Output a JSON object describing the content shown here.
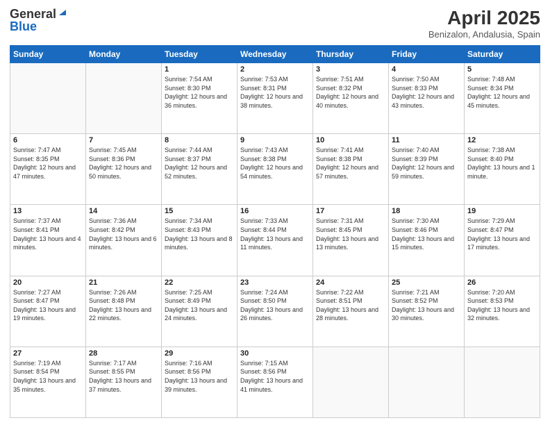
{
  "header": {
    "logo_general": "General",
    "logo_blue": "Blue",
    "month_title": "April 2025",
    "location": "Benizalon, Andalusia, Spain"
  },
  "days_of_week": [
    "Sunday",
    "Monday",
    "Tuesday",
    "Wednesday",
    "Thursday",
    "Friday",
    "Saturday"
  ],
  "weeks": [
    [
      {
        "day": "",
        "sunrise": "",
        "sunset": "",
        "daylight": ""
      },
      {
        "day": "",
        "sunrise": "",
        "sunset": "",
        "daylight": ""
      },
      {
        "day": "1",
        "sunrise": "Sunrise: 7:54 AM",
        "sunset": "Sunset: 8:30 PM",
        "daylight": "Daylight: 12 hours and 36 minutes."
      },
      {
        "day": "2",
        "sunrise": "Sunrise: 7:53 AM",
        "sunset": "Sunset: 8:31 PM",
        "daylight": "Daylight: 12 hours and 38 minutes."
      },
      {
        "day": "3",
        "sunrise": "Sunrise: 7:51 AM",
        "sunset": "Sunset: 8:32 PM",
        "daylight": "Daylight: 12 hours and 40 minutes."
      },
      {
        "day": "4",
        "sunrise": "Sunrise: 7:50 AM",
        "sunset": "Sunset: 8:33 PM",
        "daylight": "Daylight: 12 hours and 43 minutes."
      },
      {
        "day": "5",
        "sunrise": "Sunrise: 7:48 AM",
        "sunset": "Sunset: 8:34 PM",
        "daylight": "Daylight: 12 hours and 45 minutes."
      }
    ],
    [
      {
        "day": "6",
        "sunrise": "Sunrise: 7:47 AM",
        "sunset": "Sunset: 8:35 PM",
        "daylight": "Daylight: 12 hours and 47 minutes."
      },
      {
        "day": "7",
        "sunrise": "Sunrise: 7:45 AM",
        "sunset": "Sunset: 8:36 PM",
        "daylight": "Daylight: 12 hours and 50 minutes."
      },
      {
        "day": "8",
        "sunrise": "Sunrise: 7:44 AM",
        "sunset": "Sunset: 8:37 PM",
        "daylight": "Daylight: 12 hours and 52 minutes."
      },
      {
        "day": "9",
        "sunrise": "Sunrise: 7:43 AM",
        "sunset": "Sunset: 8:38 PM",
        "daylight": "Daylight: 12 hours and 54 minutes."
      },
      {
        "day": "10",
        "sunrise": "Sunrise: 7:41 AM",
        "sunset": "Sunset: 8:38 PM",
        "daylight": "Daylight: 12 hours and 57 minutes."
      },
      {
        "day": "11",
        "sunrise": "Sunrise: 7:40 AM",
        "sunset": "Sunset: 8:39 PM",
        "daylight": "Daylight: 12 hours and 59 minutes."
      },
      {
        "day": "12",
        "sunrise": "Sunrise: 7:38 AM",
        "sunset": "Sunset: 8:40 PM",
        "daylight": "Daylight: 13 hours and 1 minute."
      }
    ],
    [
      {
        "day": "13",
        "sunrise": "Sunrise: 7:37 AM",
        "sunset": "Sunset: 8:41 PM",
        "daylight": "Daylight: 13 hours and 4 minutes."
      },
      {
        "day": "14",
        "sunrise": "Sunrise: 7:36 AM",
        "sunset": "Sunset: 8:42 PM",
        "daylight": "Daylight: 13 hours and 6 minutes."
      },
      {
        "day": "15",
        "sunrise": "Sunrise: 7:34 AM",
        "sunset": "Sunset: 8:43 PM",
        "daylight": "Daylight: 13 hours and 8 minutes."
      },
      {
        "day": "16",
        "sunrise": "Sunrise: 7:33 AM",
        "sunset": "Sunset: 8:44 PM",
        "daylight": "Daylight: 13 hours and 11 minutes."
      },
      {
        "day": "17",
        "sunrise": "Sunrise: 7:31 AM",
        "sunset": "Sunset: 8:45 PM",
        "daylight": "Daylight: 13 hours and 13 minutes."
      },
      {
        "day": "18",
        "sunrise": "Sunrise: 7:30 AM",
        "sunset": "Sunset: 8:46 PM",
        "daylight": "Daylight: 13 hours and 15 minutes."
      },
      {
        "day": "19",
        "sunrise": "Sunrise: 7:29 AM",
        "sunset": "Sunset: 8:47 PM",
        "daylight": "Daylight: 13 hours and 17 minutes."
      }
    ],
    [
      {
        "day": "20",
        "sunrise": "Sunrise: 7:27 AM",
        "sunset": "Sunset: 8:47 PM",
        "daylight": "Daylight: 13 hours and 19 minutes."
      },
      {
        "day": "21",
        "sunrise": "Sunrise: 7:26 AM",
        "sunset": "Sunset: 8:48 PM",
        "daylight": "Daylight: 13 hours and 22 minutes."
      },
      {
        "day": "22",
        "sunrise": "Sunrise: 7:25 AM",
        "sunset": "Sunset: 8:49 PM",
        "daylight": "Daylight: 13 hours and 24 minutes."
      },
      {
        "day": "23",
        "sunrise": "Sunrise: 7:24 AM",
        "sunset": "Sunset: 8:50 PM",
        "daylight": "Daylight: 13 hours and 26 minutes."
      },
      {
        "day": "24",
        "sunrise": "Sunrise: 7:22 AM",
        "sunset": "Sunset: 8:51 PM",
        "daylight": "Daylight: 13 hours and 28 minutes."
      },
      {
        "day": "25",
        "sunrise": "Sunrise: 7:21 AM",
        "sunset": "Sunset: 8:52 PM",
        "daylight": "Daylight: 13 hours and 30 minutes."
      },
      {
        "day": "26",
        "sunrise": "Sunrise: 7:20 AM",
        "sunset": "Sunset: 8:53 PM",
        "daylight": "Daylight: 13 hours and 32 minutes."
      }
    ],
    [
      {
        "day": "27",
        "sunrise": "Sunrise: 7:19 AM",
        "sunset": "Sunset: 8:54 PM",
        "daylight": "Daylight: 13 hours and 35 minutes."
      },
      {
        "day": "28",
        "sunrise": "Sunrise: 7:17 AM",
        "sunset": "Sunset: 8:55 PM",
        "daylight": "Daylight: 13 hours and 37 minutes."
      },
      {
        "day": "29",
        "sunrise": "Sunrise: 7:16 AM",
        "sunset": "Sunset: 8:56 PM",
        "daylight": "Daylight: 13 hours and 39 minutes."
      },
      {
        "day": "30",
        "sunrise": "Sunrise: 7:15 AM",
        "sunset": "Sunset: 8:56 PM",
        "daylight": "Daylight: 13 hours and 41 minutes."
      },
      {
        "day": "",
        "sunrise": "",
        "sunset": "",
        "daylight": ""
      },
      {
        "day": "",
        "sunrise": "",
        "sunset": "",
        "daylight": ""
      },
      {
        "day": "",
        "sunrise": "",
        "sunset": "",
        "daylight": ""
      }
    ]
  ]
}
